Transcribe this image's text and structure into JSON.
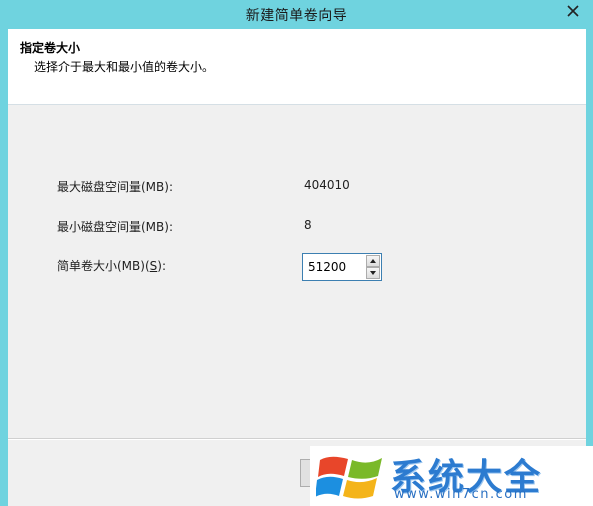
{
  "window": {
    "title": "新建简单卷向导"
  },
  "header": {
    "title": "指定卷大小",
    "subtitle": "选择介于最大和最小值的卷大小。"
  },
  "fields": {
    "max_label": "最大磁盘空间量(MB):",
    "max_value": "404010",
    "min_label": "最小磁盘空间量(MB):",
    "min_value": "8",
    "size_label_prefix": "简单卷大小(MB)(",
    "size_label_accel": "S",
    "size_label_suffix": "):",
    "size_value": "51200"
  },
  "watermark": {
    "text": "系统大全",
    "url": "www.win7cn.com"
  },
  "icons": {
    "close": "close-icon",
    "spin_up": "spin-up-icon",
    "spin_down": "spin-down-icon",
    "logo": "windows-flag-icon"
  },
  "colors": {
    "titlebar": "#6fd3df",
    "client": "#f0f0f0",
    "spinner_border": "#3c7fb1",
    "watermark_text": "#2c7bd0"
  }
}
